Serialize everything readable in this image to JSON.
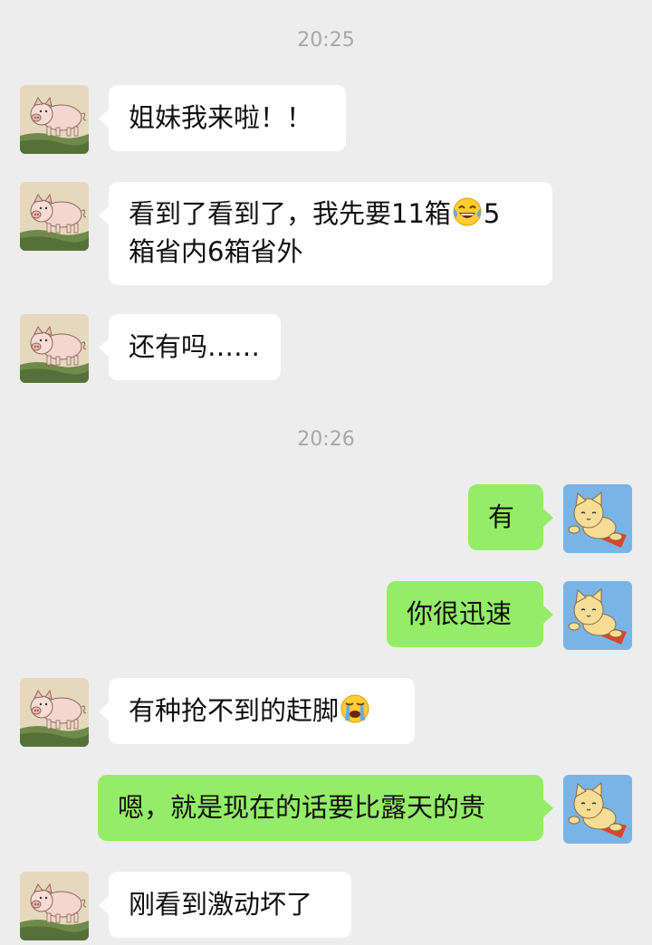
{
  "colors": {
    "background": "#ededed",
    "incoming_bubble": "#ffffff",
    "outgoing_bubble": "#95ec69",
    "timestamp_text": "#a8a8a8"
  },
  "timestamps": [
    "20:25",
    "20:26"
  ],
  "messages": [
    {
      "direction": "incoming",
      "avatar": "pig-avatar",
      "text": "姐妹我来啦！！"
    },
    {
      "direction": "incoming",
      "avatar": "pig-avatar",
      "line1_a": "看到了看到了，我先要11箱",
      "emoji1": "tears-of-joy-emoji",
      "line1_b": "5",
      "line2": "箱省内6箱省外"
    },
    {
      "direction": "incoming",
      "avatar": "pig-avatar",
      "text": "还有吗……"
    },
    {
      "direction": "outgoing",
      "avatar": "cat-avatar",
      "text": "有"
    },
    {
      "direction": "outgoing",
      "avatar": "cat-avatar",
      "text": "你很迅速"
    },
    {
      "direction": "incoming",
      "avatar": "pig-avatar",
      "text": "有种抢不到的赶脚",
      "emoji": "loudly-crying-emoji"
    },
    {
      "direction": "outgoing",
      "avatar": "cat-avatar",
      "text": "嗯，就是现在的话要比露天的贵"
    },
    {
      "direction": "incoming",
      "avatar": "pig-avatar",
      "text": "刚看到激动坏了"
    }
  ]
}
